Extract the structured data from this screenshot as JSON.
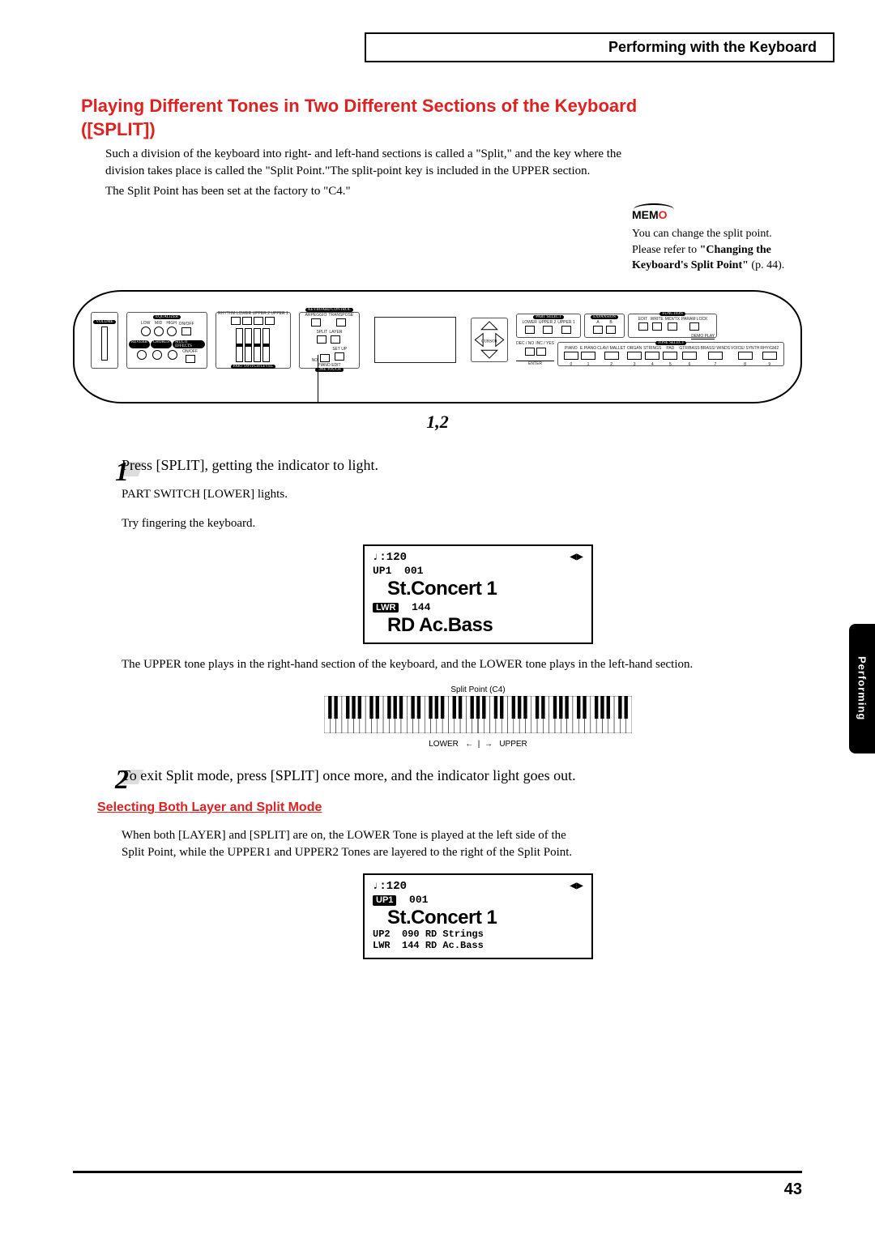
{
  "header": {
    "chapter": "Performing with the Keyboard"
  },
  "section": {
    "title": "Playing Different Tones in Two Different Sections of the Keyboard ([SPLIT])",
    "para1": "Such a division of the keyboard into right- and left-hand sections is called a \"Split,\" and the key where the division takes place is called the \"Split Point.\"The split-point key is included in the UPPER section.",
    "para2": "The Split Point has been set at the factory to \"C4.\""
  },
  "memo": {
    "label": "MEM",
    "accent": "O",
    "text1": "You can change the split point.",
    "text2a": "Please refer to ",
    "text2b": "\"Changing the Keyboard's Split Point\"",
    "text2c": " (p. 44)."
  },
  "panel": {
    "labels": {
      "volume": "VOLUME",
      "equalizer": "EQUALIZER",
      "low": "LOW",
      "mid": "MID",
      "high": "HIGH",
      "onoff": "ON/OFF",
      "reverb": "REVERB",
      "chorus": "CHORUS",
      "multieffects": "MULTI EFFECTS",
      "rhythm": "RHYTHM LOWER UPPER 2 UPPER 1",
      "partswitch": "PART SWITCH/LEVEL",
      "keyboardcontrol": "KEYBOARD CONTROL",
      "arpeggio": "ARPEGGIO",
      "transpose": "TRANSPOSE",
      "split": "SPLIT",
      "layer": "LAYER",
      "no": "NO",
      "yes": "YES",
      "setup": "SET UP",
      "pianoedit": "PIANO EDIT",
      "onetouch": "ONE TOUCH",
      "cursor": "CURSOR",
      "partselect": "PART SELECT",
      "lower": "LOWER",
      "upper2": "UPPER 2",
      "upper1": "UPPER 1",
      "expansion": "EXPANSION",
      "a": "A",
      "b": "B",
      "function": "FUNCTION",
      "edit": "EDIT",
      "write": "WRITE",
      "midi": "MIDI/TX",
      "paramlock": "PARAM LOCK",
      "demoplay": "DEMO PLAY",
      "decno": "DEC / NO",
      "incyes": "INC / YES",
      "enter": "ENTER",
      "toneselect": "TONE SELECT",
      "tone0": "PIANO",
      "tone1": "E.PIANO",
      "tone2": "CLAV/ MALLET",
      "tone3": "ORGAN",
      "tone4": "STRINGS",
      "tone5": "PAD",
      "tone6": "GTR/BASS",
      "tone7": "BRASS/ WINDS",
      "tone8": "VOICE/ SYNTH",
      "tone9": "RHY/GM2",
      "nums": [
        "0",
        "1",
        "2",
        "3",
        "4",
        "5",
        "6",
        "7",
        "8",
        "9"
      ]
    },
    "callout": "1,2"
  },
  "step1": {
    "num": "1",
    "instr": "Press [SPLIT], getting the indicator to light.",
    "sub1": "PART SWITCH [LOWER] lights.",
    "sub2": "Try fingering the keyboard.",
    "lcd": {
      "tempo": "♩:120",
      "arrows": "◀▶",
      "up1": "UP1",
      "up1num": "001",
      "up1name": "St.Concert 1",
      "lwr": "LWR",
      "lwrnum": "144",
      "lwrname": "RD Ac.Bass"
    },
    "after": "The UPPER tone plays in the right-hand section of the keyboard, and the LOWER tone plays in the left-hand section.",
    "kb": {
      "top": "Split Point (C4)",
      "bottom_lower": "LOWER",
      "arrow_left": "←",
      "arrow_right": "→",
      "bottom_upper": "UPPER"
    }
  },
  "step2": {
    "num": "2",
    "instr": "To exit Split mode, press [SPLIT] once more, and the indicator light goes out."
  },
  "sub_section": {
    "heading": "Selecting Both Layer and Split Mode",
    "para": "When both [LAYER] and [SPLIT] are on, the LOWER Tone is played at the left side of the Split Point, while the UPPER1 and UPPER2 Tones are layered to the right of the Split Point.",
    "lcd": {
      "tempo": "♩:120",
      "arrows": "◀▶",
      "up1tag": "UP1",
      "up1num": "001",
      "up1name": "St.Concert 1",
      "up2": "UP2",
      "up2line": "090 RD Strings",
      "lwr": "LWR",
      "lwrline": "144 RD Ac.Bass"
    }
  },
  "side_tab": "Performing",
  "page_number": "43"
}
